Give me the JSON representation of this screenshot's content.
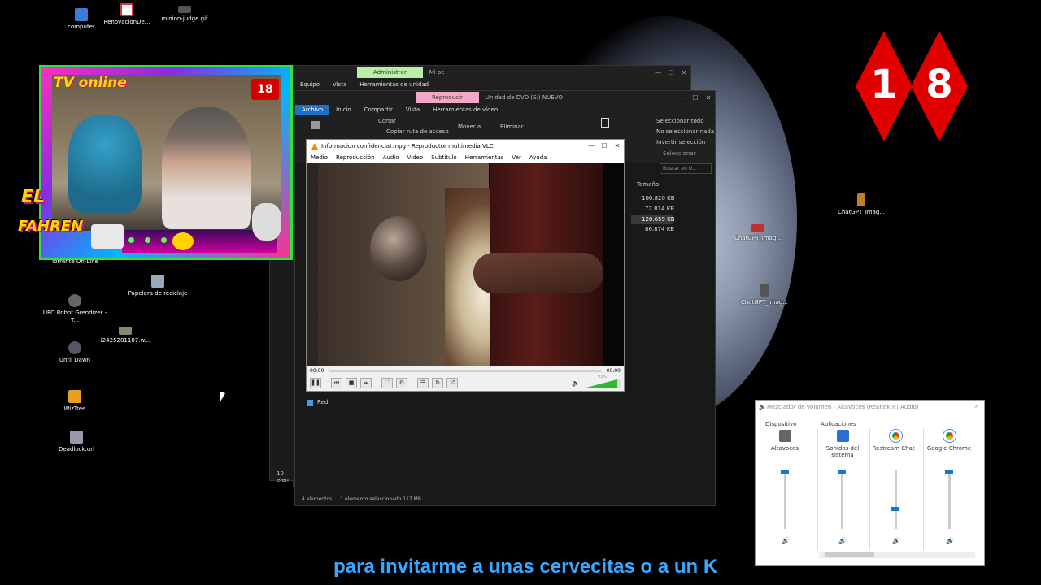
{
  "desktop_icons": [
    {
      "label": "computer",
      "name": "computer-icon",
      "color": "#3a7bd5"
    },
    {
      "label": "RenovacionDe...",
      "name": "pdf-file-icon",
      "color": "#d33"
    },
    {
      "label": "minion-judge.gif",
      "name": "gif-file-icon",
      "color": "#777"
    },
    {
      "label": "Torrente On-Line",
      "name": "torrente-shortcut-icon",
      "color": "#2a6fd1"
    },
    {
      "label": "Papelera de reciclaje",
      "name": "recycle-bin-icon",
      "color": "#9ab"
    },
    {
      "label": "UFO Robot Grendizer - T...",
      "name": "ufo-robot-icon",
      "color": "#666"
    },
    {
      "label": "i2425281187.w...",
      "name": "image-file-icon",
      "color": "#887"
    },
    {
      "label": "Until Dawn",
      "name": "until-dawn-icon",
      "color": "#556"
    },
    {
      "label": "WizTree",
      "name": "wiztree-icon",
      "color": "#e8a020"
    },
    {
      "label": "Deadlock.url",
      "name": "deadlock-url-icon",
      "color": "#99a"
    },
    {
      "label": "ChatGPT_Imag...",
      "name": "chatgpt-image-icon-1",
      "color": "#c08020"
    },
    {
      "label": "ChatGPT_Imag...",
      "name": "chatgpt-image-icon-2",
      "color": "#c03030"
    },
    {
      "label": "ChatGPT_Imag...",
      "name": "chatgpt-image-icon-3",
      "color": "#555"
    }
  ],
  "back_window": {
    "context_tab": "Administrar",
    "title": "Mi pc",
    "tabs": [
      "Equipo",
      "Vista",
      "Herramientas de unidad"
    ],
    "status": "10 elem"
  },
  "explorer": {
    "context_tab": "Reproducir",
    "title": "Unidad de DVD (E:) NUEVO",
    "tabs": [
      "Archivo",
      "Inicio",
      "Compartir",
      "Vista",
      "Herramientas de vídeo"
    ],
    "ribbon": {
      "cut": "Cortar",
      "copy_path": "Copiar ruta de acceso",
      "move_to": "Mover a",
      "delete": "Eliminar",
      "select_all": "Seleccionar todo",
      "select_none": "No seleccionar nada",
      "invert": "Invertir selección",
      "select_group": "Seleccionar"
    },
    "search_placeholder": "Buscar en U...",
    "size_header": "Tamaño",
    "sizes": [
      "100.820 KB",
      "72.814 KB",
      "120.659 KB",
      "86.874 KB"
    ],
    "nav_network": "Red",
    "status_items": "4 elementos",
    "status_selected": "1 elemento seleccionado  117 MB"
  },
  "vlc": {
    "title": "Informacion confidencial.mpg - Reproductor multimedia VLC",
    "menu": [
      "Medio",
      "Reproducción",
      "Audio",
      "Vídeo",
      "Subtítulo",
      "Herramientas",
      "Ver",
      "Ayuda"
    ],
    "time_elapsed": "00:00",
    "time_total": "00:00",
    "volume_label": "93%",
    "volume_level": 0.93
  },
  "mixer": {
    "title": "Mezclador de volumen - Altavoces (Realtek(R) Audio)",
    "device_header": "Dispositivo",
    "apps_header": "Aplicaciones",
    "channels": [
      {
        "label": "Altavoces",
        "level": 1.0
      },
      {
        "label": "Sonidos del sistema",
        "level": 1.0
      },
      {
        "label": "Restream Chat -",
        "level": 0.38
      },
      {
        "label": "Google Chrome",
        "level": 1.0
      }
    ]
  },
  "stream_overlay": {
    "brand": "TV online",
    "badge": "18",
    "el_text": "EL",
    "fahren_text": "FAHREN"
  },
  "big_badge_digits": [
    "1",
    "8"
  ],
  "ticker": "para invitarme a unas cervecitas o a un K"
}
